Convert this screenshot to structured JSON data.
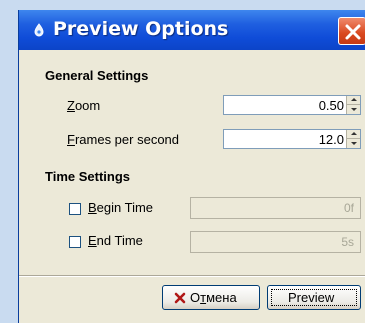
{
  "window": {
    "title": "Preview Options",
    "icon": "app-drop-icon",
    "close_icon": "close-icon"
  },
  "general": {
    "heading": "General Settings",
    "zoom": {
      "label_first": "Z",
      "label_rest": "oom",
      "value": "0.50"
    },
    "fps": {
      "label_first": "F",
      "label_rest": "rames per second",
      "value": "12.0"
    }
  },
  "time": {
    "heading": "Time Settings",
    "begin": {
      "label_first": "B",
      "label_rest": "egin Time",
      "value": "0f",
      "checked": false
    },
    "end": {
      "label_first": "E",
      "label_rest": "nd Time",
      "value": "5s",
      "checked": false
    }
  },
  "buttons": {
    "cancel": {
      "label_pre": "О",
      "label_ul": "т",
      "label_post": "мена",
      "icon": "cancel-x-icon"
    },
    "preview": {
      "label": "Preview"
    }
  },
  "colors": {
    "titlebar": "#0f4cd8",
    "close": "#d9481f",
    "dialog_bg": "#ece9d8"
  }
}
